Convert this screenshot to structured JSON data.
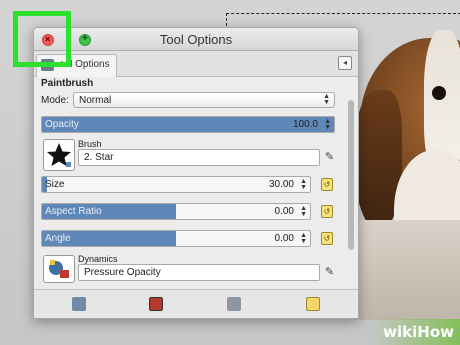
{
  "window": {
    "title": "Tool Options"
  },
  "tab": {
    "label": "ool Options",
    "menu_glyph": "◂"
  },
  "tool": {
    "name": "Paintbrush"
  },
  "mode": {
    "label": "Mode:",
    "value": "Normal"
  },
  "opacity": {
    "label": "Opacity",
    "value": "100.0",
    "fill": 1.0
  },
  "brush": {
    "label": "Brush",
    "value": "2. Star"
  },
  "size": {
    "label": "Size",
    "value": "30.00",
    "fill": 0.02
  },
  "aspect_ratio": {
    "label": "Aspect Ratio",
    "value": "0.00",
    "fill": 0.5
  },
  "angle": {
    "label": "Angle",
    "value": "0.00",
    "fill": 0.5
  },
  "dynamics": {
    "label": "Dynamics",
    "value": "Pressure Opacity"
  },
  "watermark": {
    "brand": "wikiHow"
  },
  "colors": {
    "accent": "#5f88b8",
    "highlight": "#2ee02e",
    "close": "#f25a53",
    "zoom": "#3fc249"
  }
}
